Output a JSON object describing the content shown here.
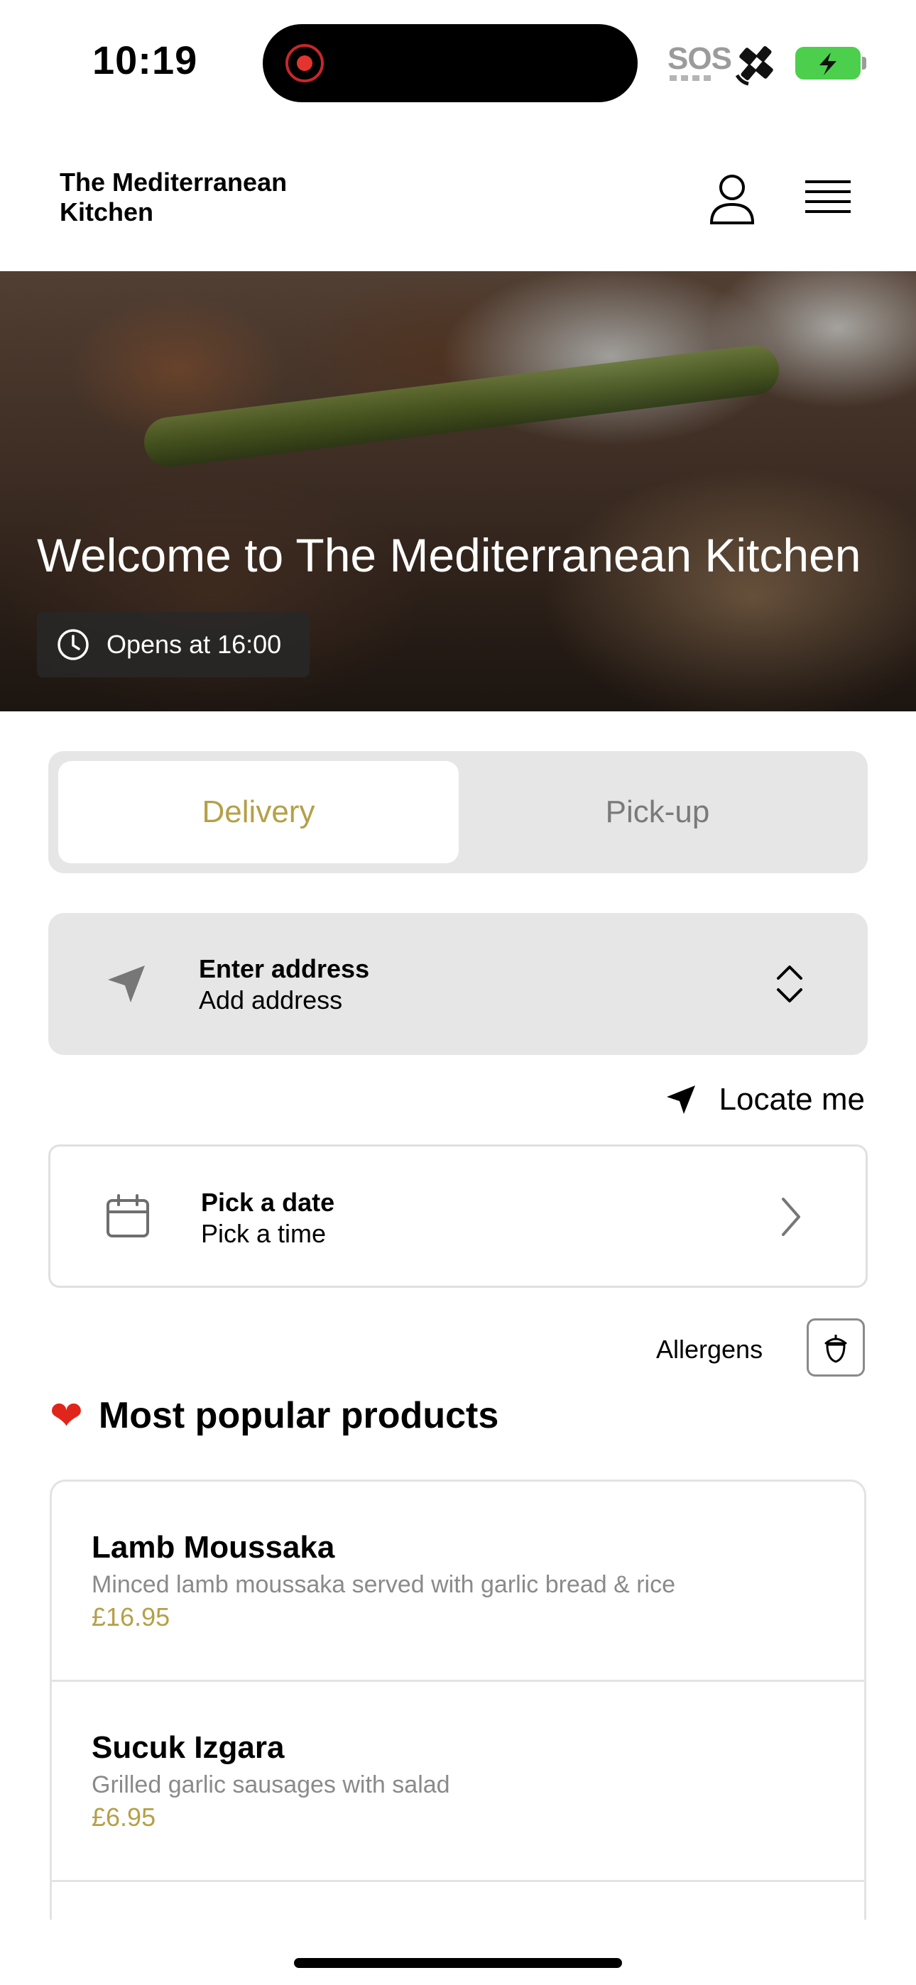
{
  "status_bar": {
    "time": "10:19",
    "sos": "SOS"
  },
  "header": {
    "restaurant_name": "The Mediterranean Kitchen"
  },
  "hero": {
    "title": "Welcome to The Mediterranean Kitchen",
    "opens_text": "Opens at 16:00"
  },
  "order_mode": {
    "tabs": [
      {
        "label": "Delivery",
        "selected": true
      },
      {
        "label": "Pick-up",
        "selected": false
      }
    ],
    "accent_color": "#b5a048"
  },
  "address": {
    "title": "Enter address",
    "subtitle": "Add address"
  },
  "locate": {
    "label": "Locate me"
  },
  "schedule": {
    "title": "Pick a date",
    "subtitle": "Pick a time"
  },
  "allergens": {
    "label": "Allergens"
  },
  "popular": {
    "heading": "Most popular products",
    "heading_icon": "heart-emoji",
    "products": [
      {
        "name": "Lamb Moussaka",
        "description": "Minced lamb moussaka served with garlic bread & rice",
        "price": "£16.95"
      },
      {
        "name": "Sucuk Izgara",
        "description": "Grilled garlic sausages with salad",
        "price": "£6.95"
      }
    ]
  }
}
